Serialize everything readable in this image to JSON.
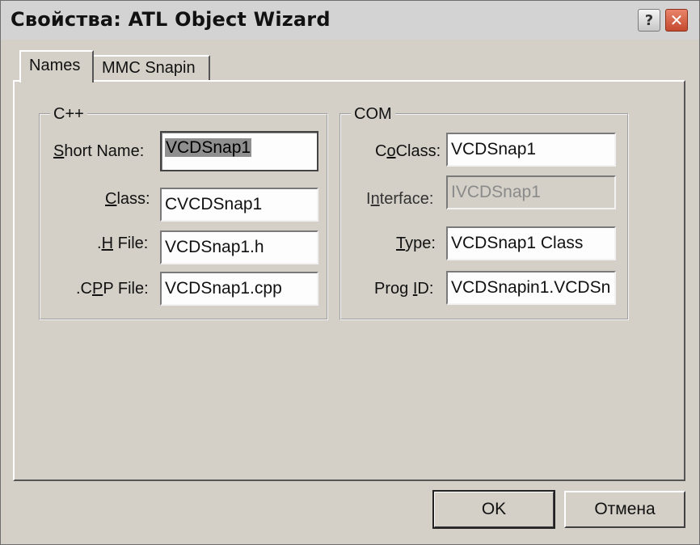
{
  "window": {
    "title": "Свойства: ATL Object Wizard"
  },
  "titlebar": {
    "help_glyph": "?",
    "close_glyph": "✕"
  },
  "tabs": [
    {
      "label": "Names",
      "active": true
    },
    {
      "label": "MMC Snapin",
      "active": false
    }
  ],
  "cpp_group": {
    "title": "C++",
    "short_name": {
      "label_pre": "",
      "label_u": "S",
      "label_post": "hort Name:",
      "value": "VCDSnap1"
    },
    "class": {
      "label_pre": "",
      "label_u": "C",
      "label_post": "lass:",
      "value": "CVCDSnap1"
    },
    "h_file": {
      "label_pre": ".",
      "label_u": "H",
      "label_post": " File:",
      "value": "VCDSnap1.h"
    },
    "cpp_file": {
      "label_pre": ".C",
      "label_u": "P",
      "label_post": "P File:",
      "value": "VCDSnap1.cpp"
    }
  },
  "com_group": {
    "title": "COM",
    "coclass": {
      "label_pre": "C",
      "label_u": "o",
      "label_post": "Class:",
      "value": "VCDSnap1"
    },
    "interface": {
      "label_pre": "I",
      "label_u": "n",
      "label_post": "terface:",
      "value": "IVCDSnap1"
    },
    "type": {
      "label_pre": "",
      "label_u": "T",
      "label_post": "ype:",
      "value": "VCDSnap1 Class"
    },
    "prog_id": {
      "label_pre": "Prog ",
      "label_u": "I",
      "label_post": "D:",
      "value": "VCDSnapin1.VCDSn"
    }
  },
  "buttons": {
    "ok": "OK",
    "cancel": "Отмена"
  }
}
